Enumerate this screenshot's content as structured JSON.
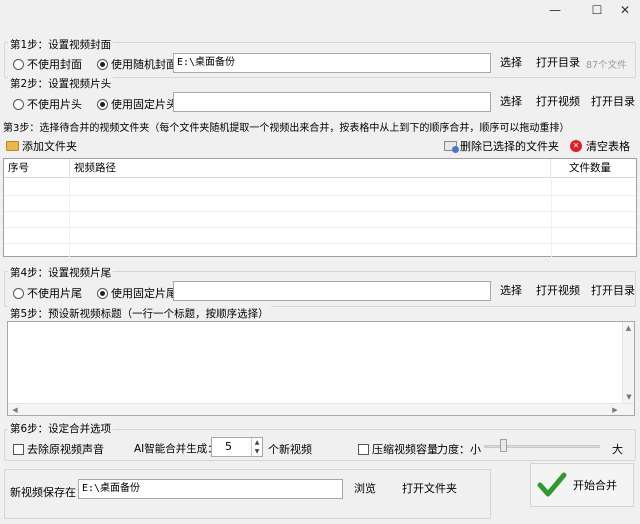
{
  "window": {
    "minimize": "—",
    "maximize": "☐",
    "close": "✕"
  },
  "step1": {
    "title": "第1步：设置视频封面",
    "option_none": "不使用封面",
    "option_random": "使用随机封面",
    "path": "E:\\桌面备份",
    "select": "选择",
    "open_dir": "打开目录",
    "count": "87个文件"
  },
  "step2": {
    "title": "第2步：设置视频片头",
    "option_none": "不使用片头",
    "option_fixed": "使用固定片头",
    "path": "",
    "select": "选择",
    "open_video": "打开视频",
    "open_dir": "打开目录"
  },
  "step3": {
    "title": "第3步：选择待合并的视频文件夹（每个文件夹随机提取一个视频出来合并，按表格中从上到下的顺序合并，顺序可以拖动重排）",
    "add_folder": "添加文件夹",
    "delete_selected": "删除已选择的文件夹",
    "clear_table": "清空表格",
    "columns": [
      "序号",
      "视频路径",
      "文件数量"
    ]
  },
  "step4": {
    "title": "第4步：设置视频片尾",
    "option_none": "不使用片尾",
    "option_fixed": "使用固定片尾",
    "path": "",
    "select": "选择",
    "open_video": "打开视频",
    "open_dir": "打开目录"
  },
  "step5": {
    "title": "第5步：预设新视频标题（一行一个标题，按顺序选择）",
    "text": ""
  },
  "step6": {
    "title": "第6步：设定合并选项",
    "remove_audio": "去除原视频声音",
    "ai_label": "AI智能合并生成：",
    "ai_count": "5",
    "ai_suffix": "个新视频",
    "compress": "压缩视频容量",
    "strength_label": "力度：小",
    "strength_max": "大",
    "strength_value": 0.15
  },
  "save": {
    "label": "新视频保存在：",
    "path": "E:\\桌面备份",
    "browse": "浏览",
    "open_folder": "打开文件夹"
  },
  "start": {
    "label": "开始合并"
  },
  "colors": {
    "check_green": "#2e9b2e",
    "clear_red": "#e02020",
    "folder_yellow": "#e8b84a"
  }
}
